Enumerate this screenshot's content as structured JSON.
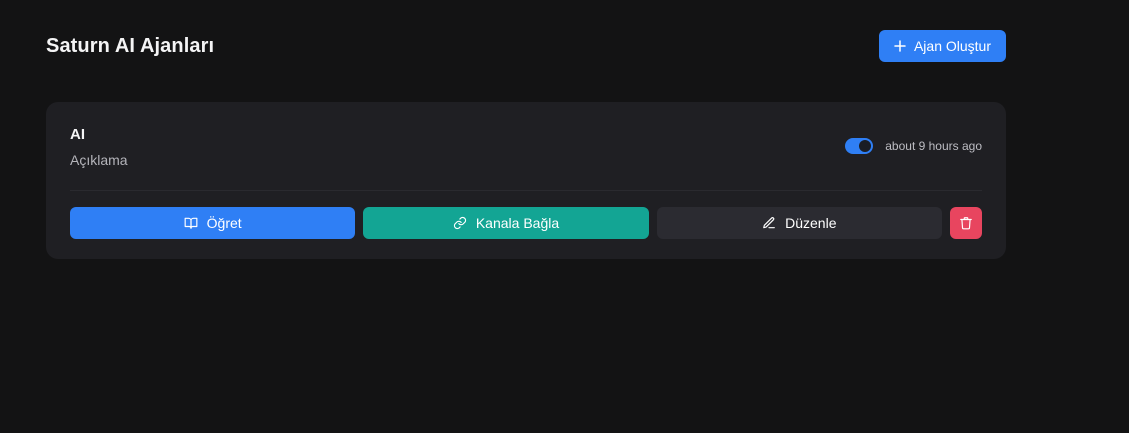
{
  "header": {
    "title": "Saturn AI Ajanları",
    "create_button_label": "Ajan Oluştur"
  },
  "agents": [
    {
      "name": "AI",
      "description": "Açıklama",
      "active": true,
      "updated": "about 9 hours ago",
      "actions": {
        "teach_label": "Öğret",
        "connect_label": "Kanala Bağla",
        "edit_label": "Düzenle"
      }
    }
  ],
  "colors": {
    "background": "#131314",
    "card": "#1f1f23",
    "primary": "#2f7ff5",
    "teal": "#13a594",
    "secondary": "#2b2b31",
    "danger": "#e8455f"
  },
  "icons": {
    "create": "plus-icon",
    "teach": "book-open-icon",
    "connect": "link-icon",
    "edit": "pencil-icon",
    "delete": "trash-icon"
  }
}
